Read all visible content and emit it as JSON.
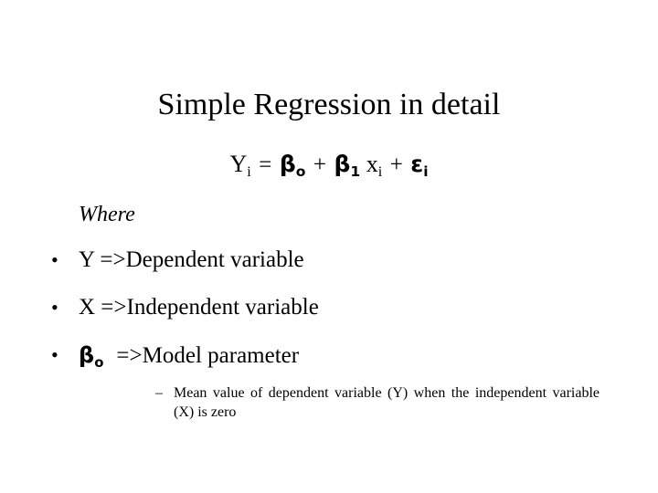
{
  "slide": {
    "title": "Simple Regression in detail",
    "background_color": "#ffffff",
    "text_color": "#000000",
    "equation": {
      "full_text": "Yi = βo + β1 xi + εi",
      "lhs_var": "Y",
      "lhs_sub": "i",
      "equals": "=",
      "beta0_sym": "β",
      "beta0_sub": "o",
      "plus1": "+",
      "beta1_sym": "β",
      "beta1_sub": "1",
      "x_var": "x",
      "x_sub": "i",
      "plus2": "+",
      "eps_sym": "ε",
      "eps_sub": "i"
    },
    "where_label": "Where",
    "bullets": [
      {
        "marker": "•",
        "type": "plain",
        "text": "Y =>Dependent variable"
      },
      {
        "marker": "•",
        "type": "plain",
        "text": "X =>Independent variable"
      },
      {
        "marker": "•",
        "type": "symbol",
        "symbol": "β",
        "symbol_sub": "o",
        "text": "=>Model parameter"
      }
    ],
    "subbullet": {
      "marker": "–",
      "line1": "Mean value of dependent variable (Y) when the",
      "line2": "independent variable (X) is zero",
      "full_text": "Mean value of dependent variable (Y) when the independent variable (X) is zero"
    }
  }
}
